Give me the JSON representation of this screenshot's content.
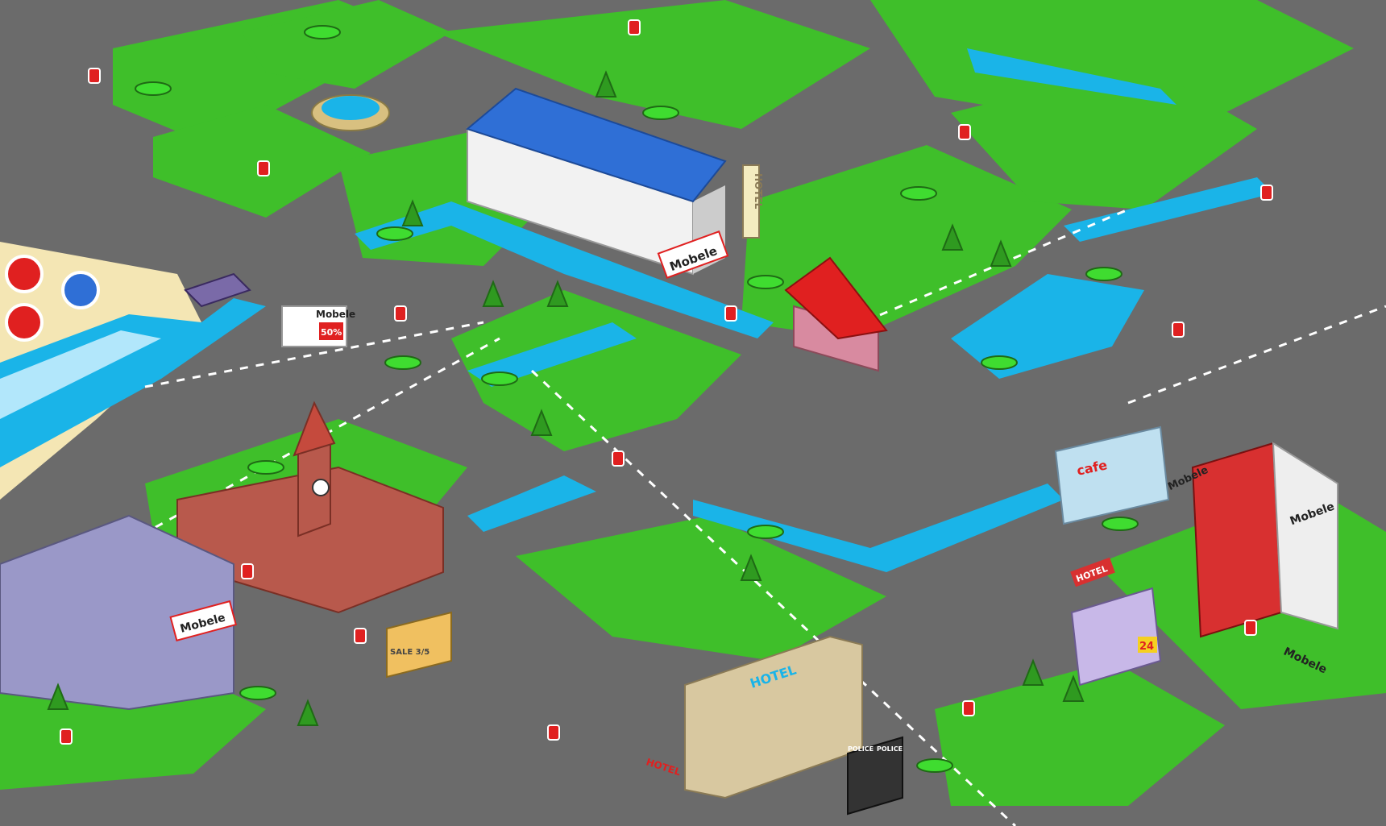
{
  "scene": {
    "type": "isometric pixel-art city map"
  },
  "signs": {
    "mobele_hq": "Mobele",
    "mobele_kiosk": "Mobele",
    "kiosk_sale": "50%",
    "mobele_left": "Mobele",
    "mobele_tower": "Mobele",
    "mobele_bottom_right": "Mobele",
    "mobele_roof_sign": "Mobele",
    "hotel_vertical": "HOTEL",
    "hotel_main": "HOTEL",
    "hotel_small": "HOTEL",
    "hotel_arrow": "HOTEL",
    "cafe": "cafe",
    "shop_24": "24",
    "police_left": "POLICE",
    "police_right": "POLICE",
    "sale_shop": "SALE 3/5",
    "logo_letter": "O"
  },
  "colors": {
    "grass": "#3fbf2a",
    "grass_dark": "#2f9a20",
    "road": "#6b6b6b",
    "road_line": "#ffffff",
    "water": "#1ab4e8",
    "sand": "#f4e6b4",
    "brand_red": "#e02020"
  }
}
